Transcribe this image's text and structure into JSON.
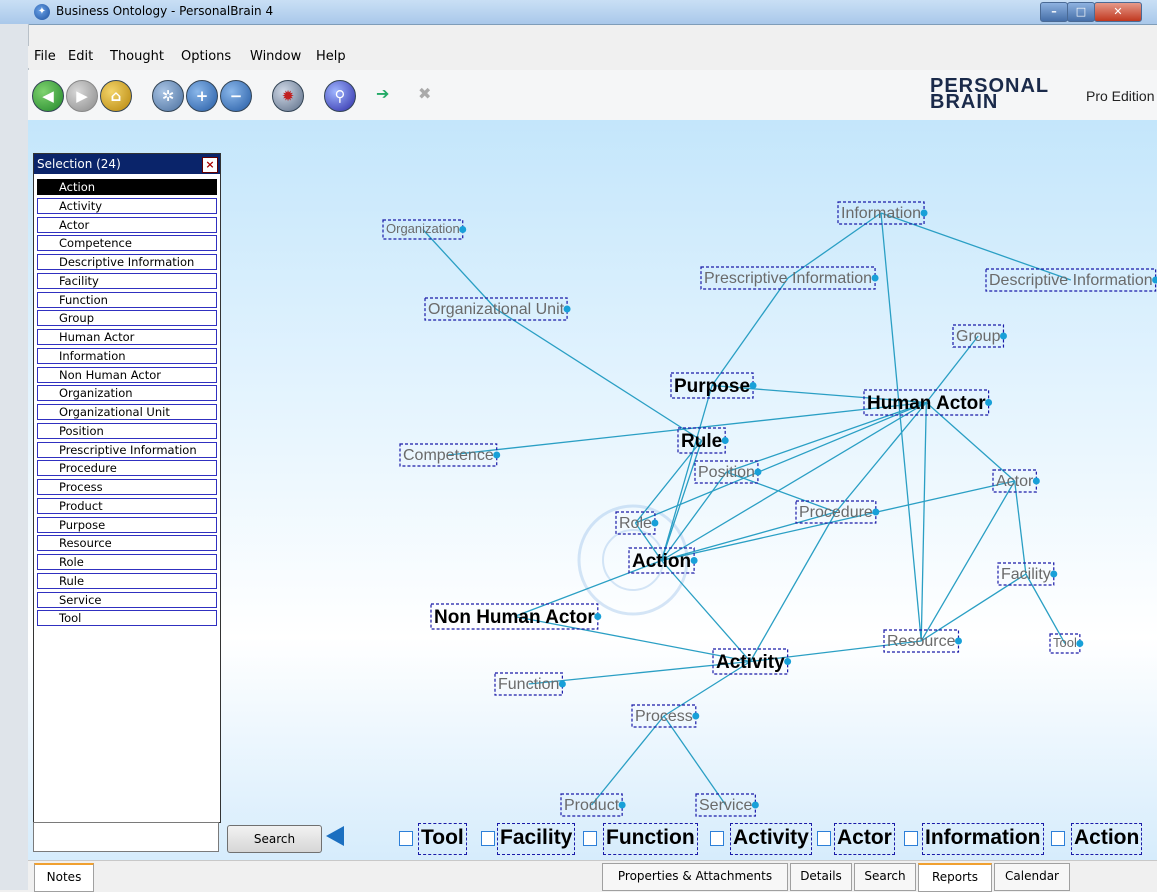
{
  "window": {
    "title": "Business Ontology - PersonalBrain 4"
  },
  "menu": [
    "File",
    "Edit",
    "Thought",
    "Options",
    "Window",
    "Help"
  ],
  "branding": {
    "logo_line1": "PERSONAL",
    "logo_line2": "BRAIN",
    "edition": "Pro Edition"
  },
  "selection_panel": {
    "title": "Selection (24)",
    "items": [
      "Action",
      "Activity",
      "Actor",
      "Competence",
      "Descriptive Information",
      "Facility",
      "Function",
      "Group",
      "Human Actor",
      "Information",
      "Non Human Actor",
      "Organization",
      "Organizational Unit",
      "Position",
      "Prescriptive Information",
      "Procedure",
      "Process",
      "Product",
      "Purpose",
      "Resource",
      "Role",
      "Rule",
      "Service",
      "Tool"
    ],
    "selected": "Action"
  },
  "search": {
    "button_label": "Search",
    "value": ""
  },
  "pins": [
    "Tool",
    "Facility",
    "Function",
    "Activity",
    "Actor",
    "Information",
    "Action"
  ],
  "tabs": [
    "Notes",
    "Properties & Attachments",
    "Details",
    "Search",
    "Reports",
    "Calendar"
  ],
  "active_tab": "Reports",
  "colors": {
    "link": "#2a9fc4",
    "node_border": "#1a1aa8",
    "active_text": "#000000",
    "inactive_text": "#6a6a6a",
    "title_bar": "#a9c8ea"
  },
  "thoughts": [
    {
      "id": "information",
      "label": "Information"
    },
    {
      "id": "organization",
      "label": "Organization"
    },
    {
      "id": "prescriptive",
      "label": "Prescriptive Information"
    },
    {
      "id": "descriptive",
      "label": "Descriptive Information"
    },
    {
      "id": "orgunit",
      "label": "Organizational Unit"
    },
    {
      "id": "group",
      "label": "Group"
    },
    {
      "id": "purpose",
      "label": "Purpose"
    },
    {
      "id": "humanactor",
      "label": "Human Actor"
    },
    {
      "id": "rule",
      "label": "Rule"
    },
    {
      "id": "competence",
      "label": "Competence"
    },
    {
      "id": "position",
      "label": "Position"
    },
    {
      "id": "actor",
      "label": "Actor"
    },
    {
      "id": "procedure",
      "label": "Procedure"
    },
    {
      "id": "role",
      "label": "Role"
    },
    {
      "id": "action",
      "label": "Action"
    },
    {
      "id": "facility",
      "label": "Facility"
    },
    {
      "id": "nonhuman",
      "label": "Non Human Actor"
    },
    {
      "id": "resource",
      "label": "Resource"
    },
    {
      "id": "tool",
      "label": "Tool"
    },
    {
      "id": "activity",
      "label": "Activity"
    },
    {
      "id": "function",
      "label": "Function"
    },
    {
      "id": "process",
      "label": "Process"
    },
    {
      "id": "product",
      "label": "Product"
    },
    {
      "id": "service",
      "label": "Service"
    }
  ],
  "links": [
    [
      "organization",
      "orgunit"
    ],
    [
      "orgunit",
      "rule"
    ],
    [
      "information",
      "prescriptive"
    ],
    [
      "information",
      "descriptive"
    ],
    [
      "information",
      "resource"
    ],
    [
      "prescriptive",
      "purpose"
    ],
    [
      "group",
      "humanactor"
    ],
    [
      "purpose",
      "humanactor"
    ],
    [
      "humanactor",
      "competence"
    ],
    [
      "humanactor",
      "actor"
    ],
    [
      "humanactor",
      "procedure"
    ],
    [
      "humanactor",
      "resource"
    ],
    [
      "humanactor",
      "role"
    ],
    [
      "humanactor",
      "action"
    ],
    [
      "humanactor",
      "position"
    ],
    [
      "purpose",
      "action"
    ],
    [
      "rule",
      "action"
    ],
    [
      "rule",
      "role"
    ],
    [
      "position",
      "action"
    ],
    [
      "position",
      "procedure"
    ],
    [
      "actor",
      "action"
    ],
    [
      "actor",
      "facility"
    ],
    [
      "actor",
      "resource"
    ],
    [
      "procedure",
      "action"
    ],
    [
      "procedure",
      "activity"
    ],
    [
      "role",
      "action"
    ],
    [
      "action",
      "nonhuman"
    ],
    [
      "action",
      "activity"
    ],
    [
      "nonhuman",
      "activity"
    ],
    [
      "facility",
      "resource"
    ],
    [
      "facility",
      "tool"
    ],
    [
      "resource",
      "activity"
    ],
    [
      "activity",
      "function"
    ],
    [
      "activity",
      "process"
    ],
    [
      "process",
      "product"
    ],
    [
      "process",
      "service"
    ]
  ]
}
